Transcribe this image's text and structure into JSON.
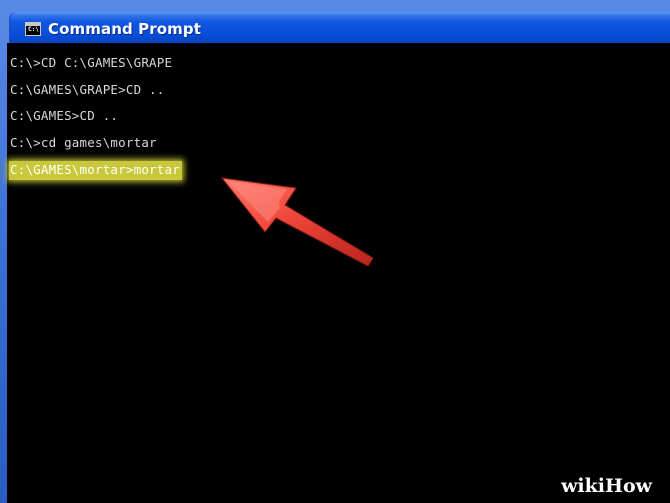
{
  "window": {
    "title": "Command Prompt",
    "icon": "cmd-icon",
    "icon_text": "C:\\"
  },
  "console": {
    "lines": [
      "C:\\>CD C:\\GAMES\\GRAPE",
      "C:\\GAMES\\GRAPE>CD ..",
      "C:\\GAMES>CD ..",
      "C:\\>cd games\\mortar"
    ],
    "highlighted_line": "C:\\GAMES\\mortar>mortar"
  },
  "annotation": {
    "type": "arrow",
    "color": "#e8423a",
    "points_to": "highlighted_line"
  },
  "watermark": "wikiHow"
}
